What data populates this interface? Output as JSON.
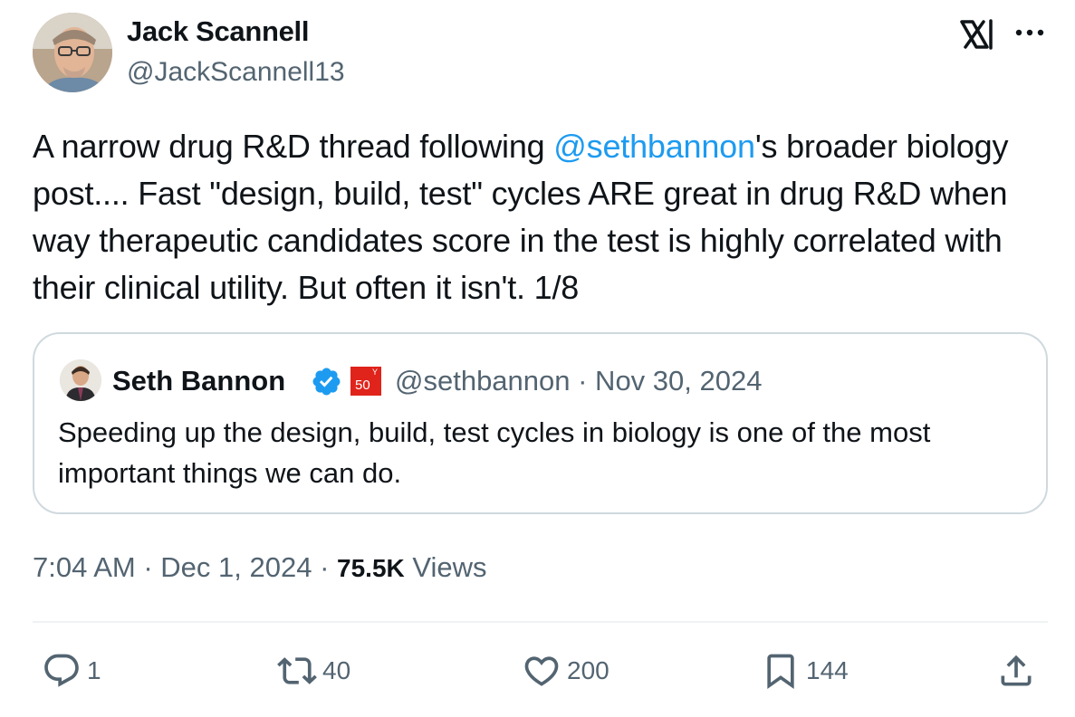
{
  "author": {
    "name": "Jack Scannell",
    "handle": "@JackScannell13"
  },
  "tweet": {
    "text_before": "A narrow drug R&D thread following ",
    "mention": "@sethbannon",
    "text_after": "'s broader biology post.... Fast \"design, build, test\" cycles ARE great in drug R&D when way therapeutic candidates score in the test is highly correlated with their clinical utility.  But often it isn't. 1/8"
  },
  "quote": {
    "name": "Seth Bannon",
    "badge_number": "50",
    "badge_letter": "Y",
    "meta": "@sethbannon · Nov 30, 2024",
    "text": "Speeding up the design, build, test cycles in biology is one of the most important things we can do."
  },
  "meta": {
    "time_date": "7:04 AM · Dec 1, 2024 · ",
    "views_count": "75.5K",
    "views_label": " Views"
  },
  "actions": {
    "replies": "1",
    "retweets": "40",
    "likes": "200",
    "bookmarks": "144"
  },
  "colors": {
    "link": "#1d9bf0",
    "secondary_text": "#536471",
    "border": "#cfd9de",
    "verified": "#1d9bf0",
    "badge": "#e0231b"
  },
  "icons": [
    "x-logo-icon",
    "more-icon",
    "verified-icon",
    "reply-icon",
    "retweet-icon",
    "like-icon",
    "bookmark-icon",
    "share-icon"
  ]
}
